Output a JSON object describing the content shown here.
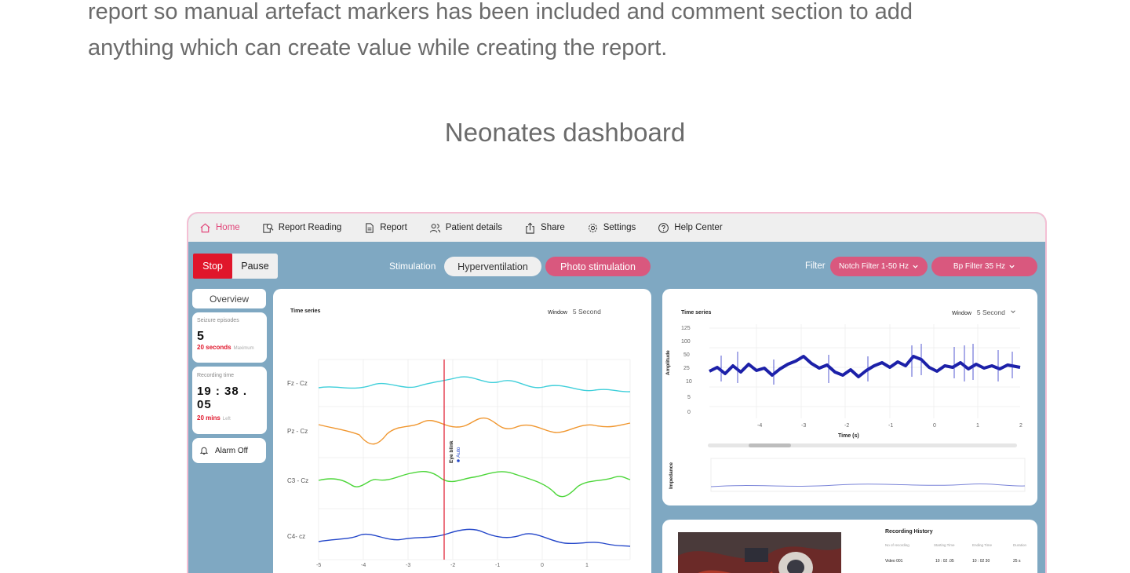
{
  "article": {
    "line1": "report so manual artefact markers has been included and comment section to add",
    "line2": "anything which can create value while creating the report."
  },
  "caption": "Neonates dashboard",
  "nav": {
    "items": [
      {
        "label": "Home",
        "icon": "home-icon"
      },
      {
        "label": "Report Reading",
        "icon": "report-search-icon"
      },
      {
        "label": "Report",
        "icon": "document-icon"
      },
      {
        "label": "Patient details",
        "icon": "users-icon"
      },
      {
        "label": "Share",
        "icon": "share-icon"
      },
      {
        "label": "Settings",
        "icon": "gear-icon"
      },
      {
        "label": "Help Center",
        "icon": "help-icon"
      }
    ]
  },
  "controls": {
    "stop": "Stop",
    "pause": "Pause",
    "stimulation_label": "Stimulation",
    "hyperventilation": "Hyperventilation",
    "photo_stimulation": "Photo stimulation",
    "filter_label": "Filter",
    "notch_filter": "Notch Filter 1-50 Hz",
    "bp_filter": "Bp Filter 35 Hz"
  },
  "sidebar": {
    "overview": "Overview",
    "seizure_label": "Seizure episodes",
    "seizure_count": "5",
    "seizure_duration": "20 seconds",
    "seizure_duration_note": "Maximum",
    "recording_label": "Recording time",
    "recording_time": "19 : 38 . 05",
    "recording_remaining": "20 mins",
    "recording_remaining_note": "Left",
    "alarm": "Alarm Off"
  },
  "main_panel": {
    "title": "Time series",
    "window_label": "Window",
    "window_value": "5 Second",
    "marker_label": "Eye blink",
    "marker_sub": "Auto",
    "channels": [
      "Fz - Cz",
      "Pz - Cz",
      "C3 - Cz",
      "C4- cz"
    ],
    "x_ticks": [
      "-5",
      "-4",
      "-3",
      "-2",
      "-1",
      "0",
      "1"
    ]
  },
  "right_panel": {
    "title": "Time series",
    "window_label": "Window",
    "window_value": "5 Second",
    "y_label": "Amplitude",
    "y_ticks": [
      "125",
      "100",
      "50",
      "25",
      "10",
      "5",
      "0"
    ],
    "x_ticks": [
      "-4",
      "-3",
      "-2",
      "-1",
      "0",
      "1",
      "2"
    ],
    "x_label": "Time (s)",
    "impedance_label": "Impedance"
  },
  "recording_history": {
    "title": "Recording History",
    "headers": [
      "No of recording",
      "Starting Time",
      "Ending Time",
      "Duration"
    ],
    "rows": [
      [
        "Video 001",
        "10 : 02 .05",
        "10 : 02 30",
        "25 s"
      ]
    ]
  },
  "colors": {
    "accent_pink": "#d9587e",
    "stop_red": "#e0162b",
    "dashboard_bg": "#7fa8c2",
    "trace_cyan": "#3fcfda",
    "trace_orange": "#f0962e",
    "trace_green": "#4cd639",
    "trace_blue": "#2346c9"
  }
}
